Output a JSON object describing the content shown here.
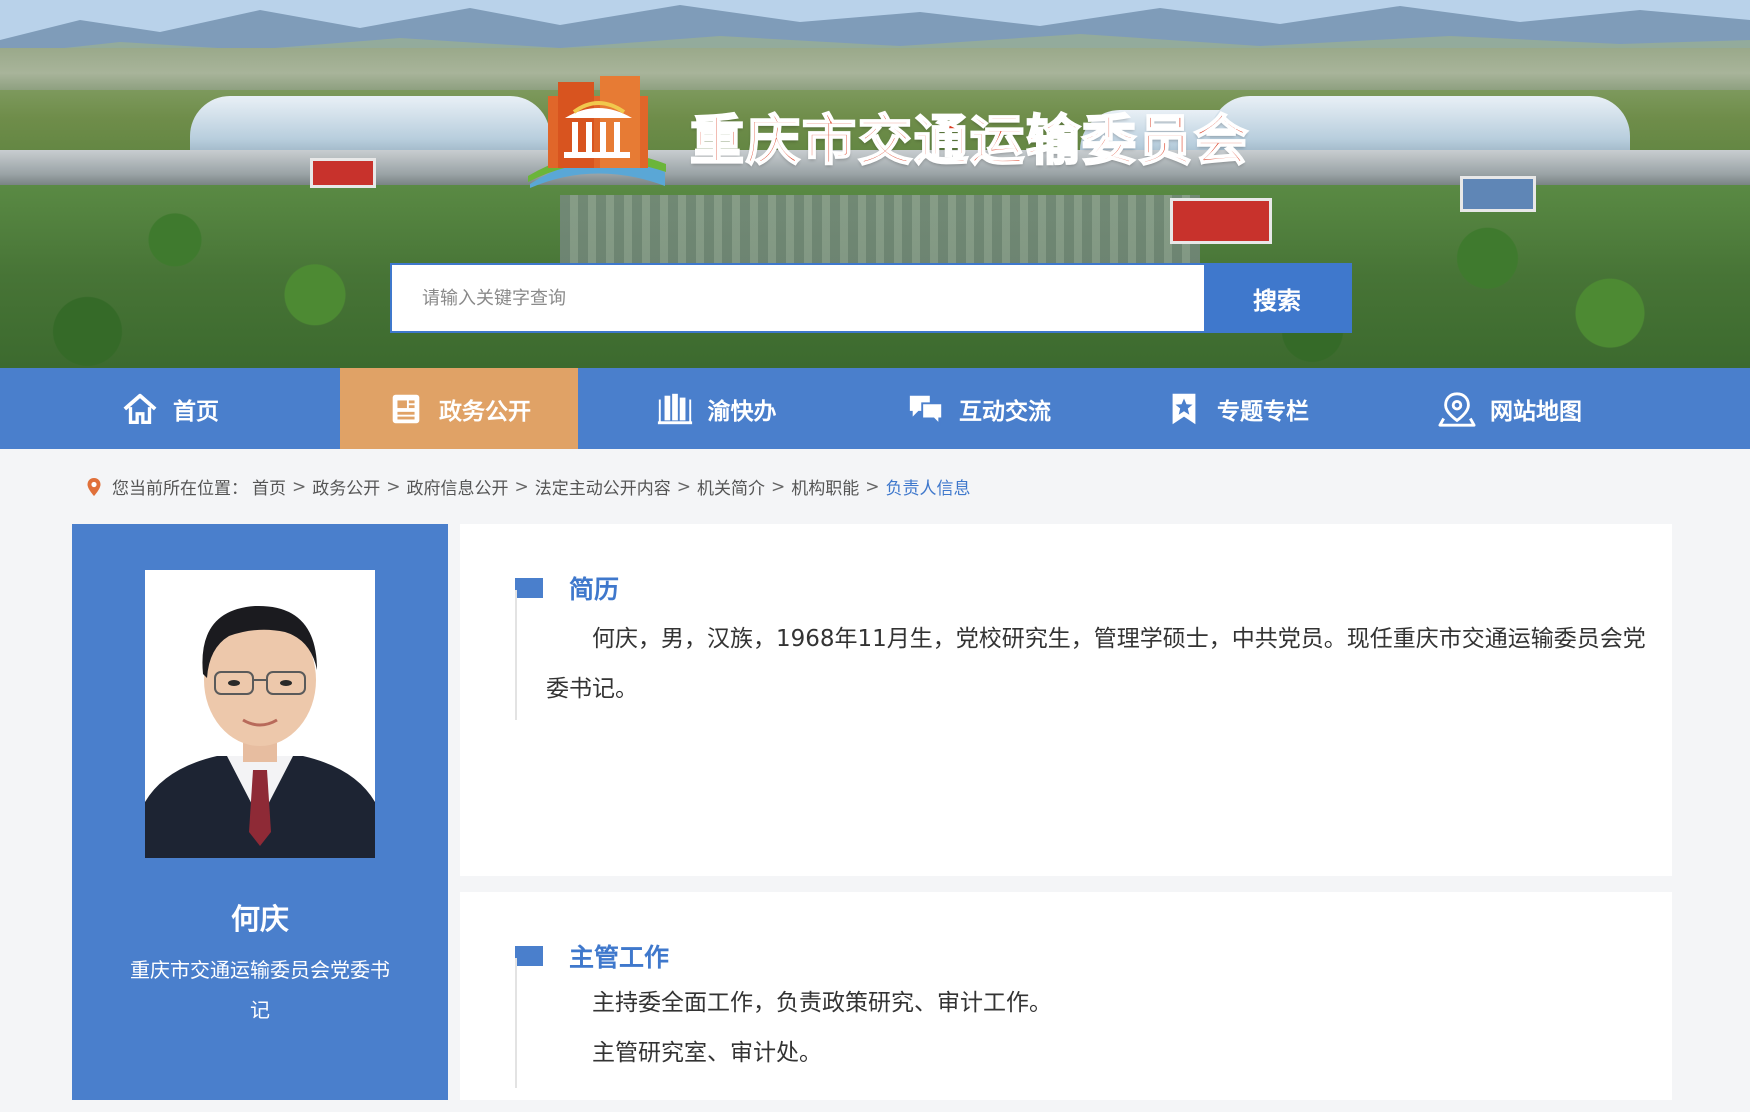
{
  "site": {
    "title": "重庆市交通运输委员会"
  },
  "search": {
    "placeholder": "请输入关键字查询",
    "button_label": "搜索"
  },
  "nav": {
    "items": [
      {
        "label": "首页",
        "icon": "home-icon",
        "active": false
      },
      {
        "label": "政务公开",
        "icon": "document-icon",
        "active": true
      },
      {
        "label": "渝快办",
        "icon": "book-icon",
        "active": false
      },
      {
        "label": "互动交流",
        "icon": "chat-icon",
        "active": false
      },
      {
        "label": "专题专栏",
        "icon": "bookmark-star-icon",
        "active": false
      },
      {
        "label": "网站地图",
        "icon": "map-pin-icon",
        "active": false
      }
    ]
  },
  "breadcrumb": {
    "prefix": "您当前所在位置：",
    "items": [
      "首页",
      "政务公开",
      "政府信息公开",
      "法定主动公开内容",
      "机关简介",
      "机构职能"
    ],
    "current": "负责人信息",
    "separator": ">"
  },
  "person": {
    "name": "何庆",
    "title": "重庆市交通运输委员会党委书记"
  },
  "sections": {
    "resume": {
      "heading": "简历",
      "text": "何庆，男，汉族，1968年11月生，党校研究生，管理学硕士，中共党员。现任重庆市交通运输委员会党委书记。"
    },
    "duties": {
      "heading": "主管工作",
      "lines": [
        "主持委全面工作，负责政策研究、审计工作。",
        "主管研究室、审计处。"
      ]
    }
  },
  "colors": {
    "primary_blue": "#4a7fcc",
    "active_tab": "#e0a266",
    "title_red": "#d93a1f"
  }
}
